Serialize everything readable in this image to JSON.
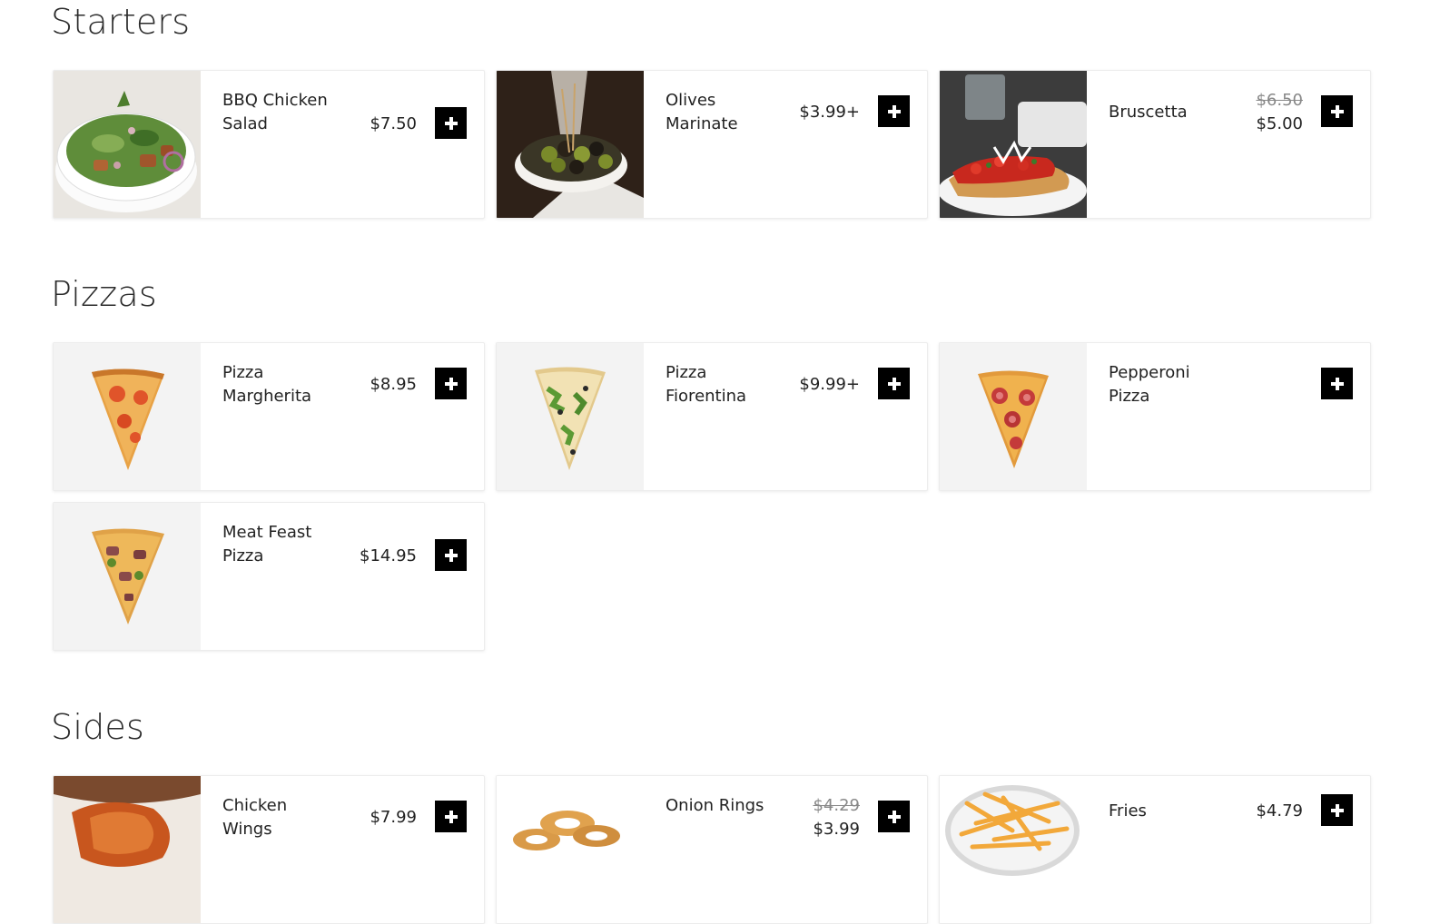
{
  "sections": {
    "starters": {
      "title": "Starters",
      "items": [
        {
          "name": "BBQ Chicken Salad",
          "price": "$7.50",
          "image": "salad-bowl-photo"
        },
        {
          "name": "Olives Marinate",
          "price": "$3.99+",
          "image": "olives-bowl-photo"
        },
        {
          "name": "Bruscetta",
          "old_price": "$6.50",
          "price": "$5.00",
          "image": "bruschetta-plate-photo"
        }
      ]
    },
    "pizzas": {
      "title": "Pizzas",
      "items": [
        {
          "name": "Pizza Margherita",
          "price": "$8.95",
          "image": "pizza-slice-margherita"
        },
        {
          "name": "Pizza Fiorentina",
          "price": "$9.99+",
          "image": "pizza-slice-fiorentina"
        },
        {
          "name": "Pepperoni Pizza",
          "price": "",
          "image": "pizza-slice-pepperoni"
        },
        {
          "name": "Meat Feast Pizza",
          "price": "$14.95",
          "image": "pizza-slice-meat-feast"
        }
      ]
    },
    "sides": {
      "title": "Sides",
      "items": [
        {
          "name": "Chicken Wings",
          "price": "$7.99",
          "image": "chicken-wings-photo"
        },
        {
          "name": "Onion Rings",
          "old_price": "$4.29",
          "price": "$3.99",
          "image": "onion-rings-photo"
        },
        {
          "name": "Fries",
          "price": "$4.79",
          "image": "fries-photo"
        }
      ]
    }
  },
  "colors": {
    "add_button": "#000000",
    "card_border": "#ececec",
    "thumb_bg": "#f3f3f3"
  },
  "icons": {
    "add": "plus-icon"
  }
}
